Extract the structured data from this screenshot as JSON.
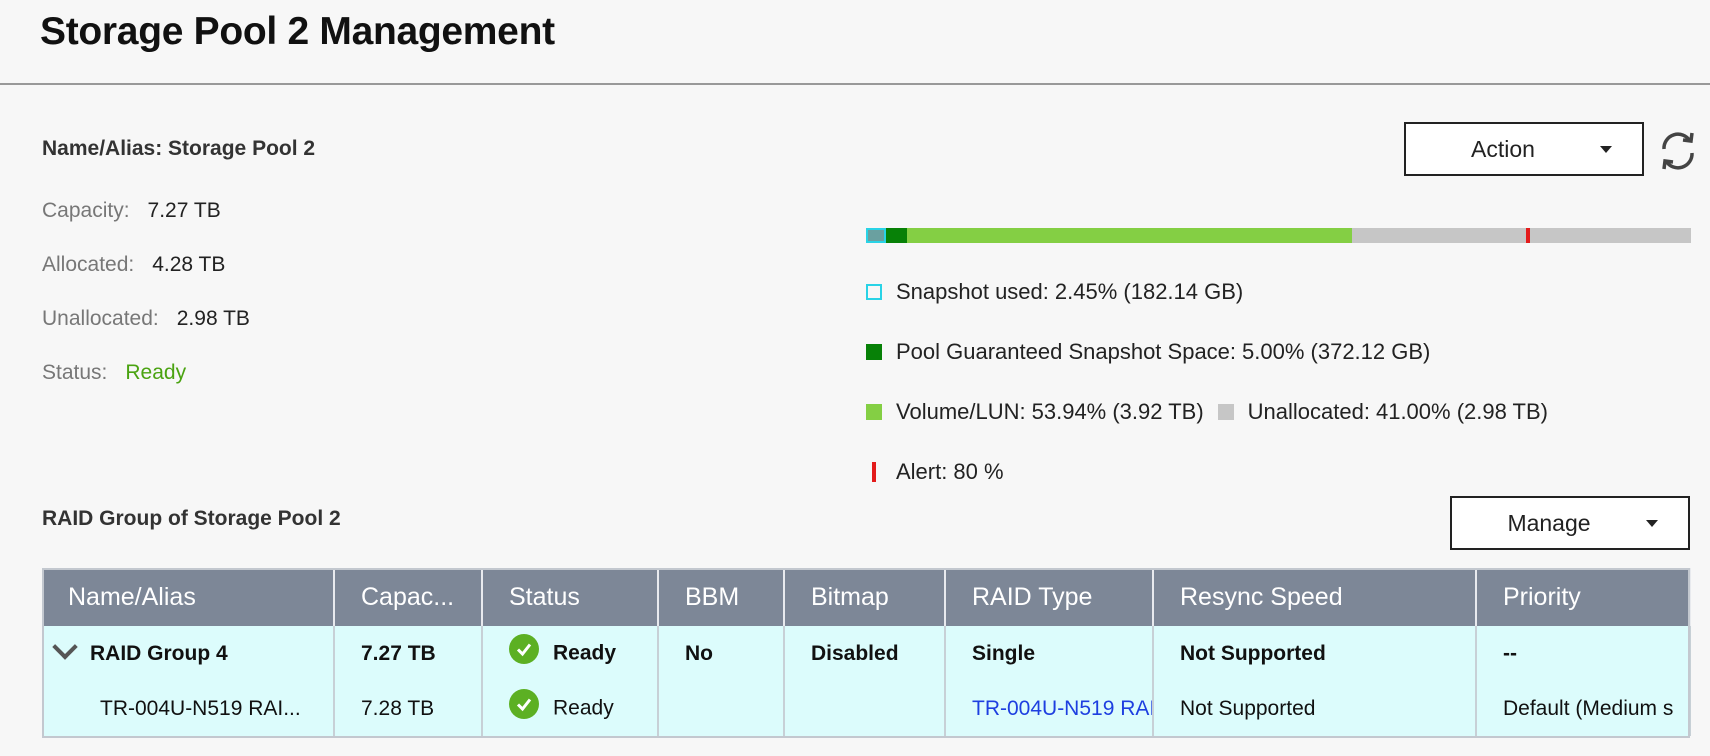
{
  "header": {
    "title": "Storage Pool 2 Management"
  },
  "pool": {
    "name_alias": "Name/Alias: Storage Pool 2",
    "capacity_label": "Capacity:",
    "capacity_value": "7.27 TB",
    "allocated_label": "Allocated:",
    "allocated_value": "4.28 TB",
    "unallocated_label": "Unallocated:",
    "unallocated_value": "2.98 TB",
    "status_label": "Status:",
    "status_value": "Ready"
  },
  "toolbar": {
    "action_label": "Action",
    "manage_label": "Manage",
    "refresh_icon": "refresh-icon"
  },
  "usage_bar": {
    "snapshot_used_pct": 2.45,
    "guaranteed_pct": 5.0,
    "volume_pct": 53.94,
    "unallocated_pct": 41.0,
    "alert_pct": 80
  },
  "legend": {
    "snapshot_name": "Snapshot used:",
    "snapshot_value": "2.45% (182.14 GB)",
    "guaranteed_name": "Pool Guaranteed Snapshot Space:",
    "guaranteed_value": "5.00% (372.12 GB)",
    "volume_name": "Volume/LUN:",
    "volume_value": "53.94% (3.92 TB)",
    "unallocated_name": "Unallocated:",
    "unallocated_value": "41.00% (2.98 TB)",
    "alert_name": "Alert:",
    "alert_value": "80 %"
  },
  "colors": {
    "snapshot": "#29d3e6",
    "guaranteed": "#078107",
    "volume": "#84cf44",
    "unallocated": "#c6c6c6",
    "alert": "#e31b1b",
    "ready": "#4aa311"
  },
  "raid_section": {
    "title": "RAID Group of Storage Pool 2"
  },
  "table": {
    "columns": [
      "Name/Alias",
      "Capac...",
      "Status",
      "BBM",
      "Bitmap",
      "RAID Type",
      "Resync Speed",
      "Priority"
    ],
    "group_row": {
      "name": "RAID Group 4",
      "capacity": "7.27 TB",
      "status": "Ready",
      "bbm": "No",
      "bitmap": "Disabled",
      "raid_type": "Single",
      "resync": "Not Supported",
      "priority": "--"
    },
    "disk_row": {
      "name": "TR-004U-N519 RAI...",
      "capacity": "7.28 TB",
      "status": "Ready",
      "bbm": "",
      "bitmap": "",
      "raid_type": "TR-004U-N519 RAI",
      "resync": "Not Supported",
      "priority": "Default (Medium s"
    }
  }
}
